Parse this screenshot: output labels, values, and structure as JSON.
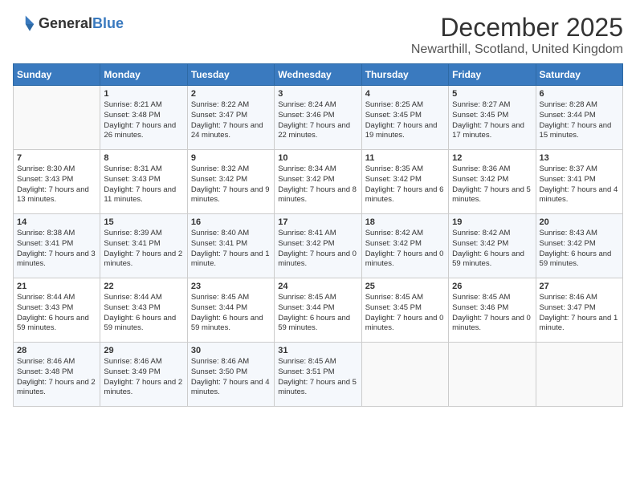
{
  "logo": {
    "text_general": "General",
    "text_blue": "Blue"
  },
  "header": {
    "month": "December 2025",
    "location": "Newarthill, Scotland, United Kingdom"
  },
  "weekdays": [
    "Sunday",
    "Monday",
    "Tuesday",
    "Wednesday",
    "Thursday",
    "Friday",
    "Saturday"
  ],
  "weeks": [
    [
      {
        "day": "",
        "sunrise": "",
        "sunset": "",
        "daylight": ""
      },
      {
        "day": "1",
        "sunrise": "Sunrise: 8:21 AM",
        "sunset": "Sunset: 3:48 PM",
        "daylight": "Daylight: 7 hours and 26 minutes."
      },
      {
        "day": "2",
        "sunrise": "Sunrise: 8:22 AM",
        "sunset": "Sunset: 3:47 PM",
        "daylight": "Daylight: 7 hours and 24 minutes."
      },
      {
        "day": "3",
        "sunrise": "Sunrise: 8:24 AM",
        "sunset": "Sunset: 3:46 PM",
        "daylight": "Daylight: 7 hours and 22 minutes."
      },
      {
        "day": "4",
        "sunrise": "Sunrise: 8:25 AM",
        "sunset": "Sunset: 3:45 PM",
        "daylight": "Daylight: 7 hours and 19 minutes."
      },
      {
        "day": "5",
        "sunrise": "Sunrise: 8:27 AM",
        "sunset": "Sunset: 3:45 PM",
        "daylight": "Daylight: 7 hours and 17 minutes."
      },
      {
        "day": "6",
        "sunrise": "Sunrise: 8:28 AM",
        "sunset": "Sunset: 3:44 PM",
        "daylight": "Daylight: 7 hours and 15 minutes."
      }
    ],
    [
      {
        "day": "7",
        "sunrise": "Sunrise: 8:30 AM",
        "sunset": "Sunset: 3:43 PM",
        "daylight": "Daylight: 7 hours and 13 minutes."
      },
      {
        "day": "8",
        "sunrise": "Sunrise: 8:31 AM",
        "sunset": "Sunset: 3:43 PM",
        "daylight": "Daylight: 7 hours and 11 minutes."
      },
      {
        "day": "9",
        "sunrise": "Sunrise: 8:32 AM",
        "sunset": "Sunset: 3:42 PM",
        "daylight": "Daylight: 7 hours and 9 minutes."
      },
      {
        "day": "10",
        "sunrise": "Sunrise: 8:34 AM",
        "sunset": "Sunset: 3:42 PM",
        "daylight": "Daylight: 7 hours and 8 minutes."
      },
      {
        "day": "11",
        "sunrise": "Sunrise: 8:35 AM",
        "sunset": "Sunset: 3:42 PM",
        "daylight": "Daylight: 7 hours and 6 minutes."
      },
      {
        "day": "12",
        "sunrise": "Sunrise: 8:36 AM",
        "sunset": "Sunset: 3:42 PM",
        "daylight": "Daylight: 7 hours and 5 minutes."
      },
      {
        "day": "13",
        "sunrise": "Sunrise: 8:37 AM",
        "sunset": "Sunset: 3:41 PM",
        "daylight": "Daylight: 7 hours and 4 minutes."
      }
    ],
    [
      {
        "day": "14",
        "sunrise": "Sunrise: 8:38 AM",
        "sunset": "Sunset: 3:41 PM",
        "daylight": "Daylight: 7 hours and 3 minutes."
      },
      {
        "day": "15",
        "sunrise": "Sunrise: 8:39 AM",
        "sunset": "Sunset: 3:41 PM",
        "daylight": "Daylight: 7 hours and 2 minutes."
      },
      {
        "day": "16",
        "sunrise": "Sunrise: 8:40 AM",
        "sunset": "Sunset: 3:41 PM",
        "daylight": "Daylight: 7 hours and 1 minute."
      },
      {
        "day": "17",
        "sunrise": "Sunrise: 8:41 AM",
        "sunset": "Sunset: 3:42 PM",
        "daylight": "Daylight: 7 hours and 0 minutes."
      },
      {
        "day": "18",
        "sunrise": "Sunrise: 8:42 AM",
        "sunset": "Sunset: 3:42 PM",
        "daylight": "Daylight: 7 hours and 0 minutes."
      },
      {
        "day": "19",
        "sunrise": "Sunrise: 8:42 AM",
        "sunset": "Sunset: 3:42 PM",
        "daylight": "Daylight: 6 hours and 59 minutes."
      },
      {
        "day": "20",
        "sunrise": "Sunrise: 8:43 AM",
        "sunset": "Sunset: 3:42 PM",
        "daylight": "Daylight: 6 hours and 59 minutes."
      }
    ],
    [
      {
        "day": "21",
        "sunrise": "Sunrise: 8:44 AM",
        "sunset": "Sunset: 3:43 PM",
        "daylight": "Daylight: 6 hours and 59 minutes."
      },
      {
        "day": "22",
        "sunrise": "Sunrise: 8:44 AM",
        "sunset": "Sunset: 3:43 PM",
        "daylight": "Daylight: 6 hours and 59 minutes."
      },
      {
        "day": "23",
        "sunrise": "Sunrise: 8:45 AM",
        "sunset": "Sunset: 3:44 PM",
        "daylight": "Daylight: 6 hours and 59 minutes."
      },
      {
        "day": "24",
        "sunrise": "Sunrise: 8:45 AM",
        "sunset": "Sunset: 3:44 PM",
        "daylight": "Daylight: 6 hours and 59 minutes."
      },
      {
        "day": "25",
        "sunrise": "Sunrise: 8:45 AM",
        "sunset": "Sunset: 3:45 PM",
        "daylight": "Daylight: 7 hours and 0 minutes."
      },
      {
        "day": "26",
        "sunrise": "Sunrise: 8:45 AM",
        "sunset": "Sunset: 3:46 PM",
        "daylight": "Daylight: 7 hours and 0 minutes."
      },
      {
        "day": "27",
        "sunrise": "Sunrise: 8:46 AM",
        "sunset": "Sunset: 3:47 PM",
        "daylight": "Daylight: 7 hours and 1 minute."
      }
    ],
    [
      {
        "day": "28",
        "sunrise": "Sunrise: 8:46 AM",
        "sunset": "Sunset: 3:48 PM",
        "daylight": "Daylight: 7 hours and 2 minutes."
      },
      {
        "day": "29",
        "sunrise": "Sunrise: 8:46 AM",
        "sunset": "Sunset: 3:49 PM",
        "daylight": "Daylight: 7 hours and 2 minutes."
      },
      {
        "day": "30",
        "sunrise": "Sunrise: 8:46 AM",
        "sunset": "Sunset: 3:50 PM",
        "daylight": "Daylight: 7 hours and 4 minutes."
      },
      {
        "day": "31",
        "sunrise": "Sunrise: 8:45 AM",
        "sunset": "Sunset: 3:51 PM",
        "daylight": "Daylight: 7 hours and 5 minutes."
      },
      {
        "day": "",
        "sunrise": "",
        "sunset": "",
        "daylight": ""
      },
      {
        "day": "",
        "sunrise": "",
        "sunset": "",
        "daylight": ""
      },
      {
        "day": "",
        "sunrise": "",
        "sunset": "",
        "daylight": ""
      }
    ]
  ]
}
